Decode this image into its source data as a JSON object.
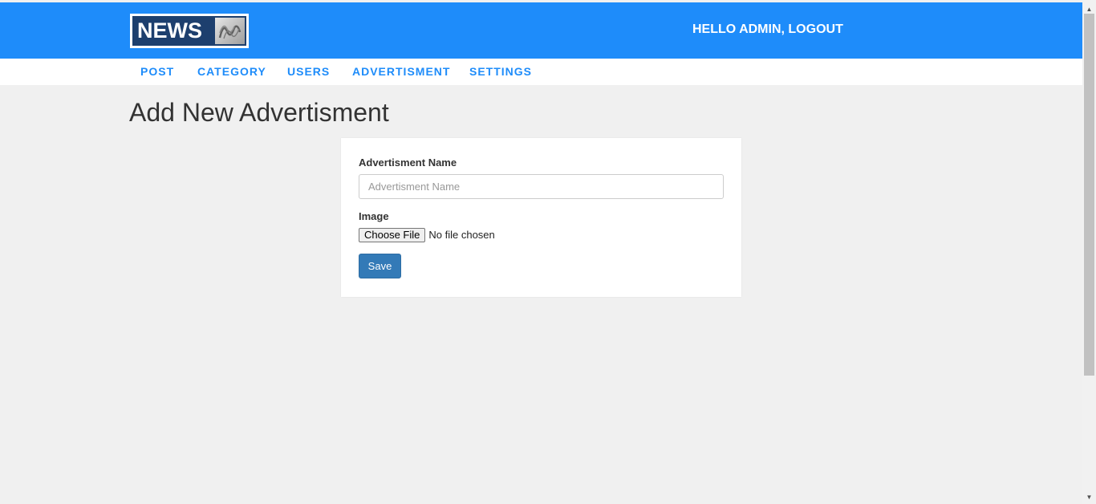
{
  "header": {
    "logo_text": "NEWS",
    "user_greeting": "HELLO ADMIN,",
    "logout_label": "LOGOUT"
  },
  "nav": {
    "items": [
      {
        "label": "POST"
      },
      {
        "label": "CATEGORY"
      },
      {
        "label": "USERS"
      },
      {
        "label": "ADVERTISMENT"
      },
      {
        "label": "SETTINGS"
      }
    ]
  },
  "main": {
    "title": "Add New Advertisment",
    "form": {
      "name_label": "Advertisment Name",
      "name_placeholder": "Advertisment Name",
      "name_value": "",
      "image_label": "Image",
      "file_button_label": "Choose File",
      "file_status": "No file chosen",
      "save_label": "Save"
    }
  },
  "scrollbar": {
    "up_arrow": "▲",
    "down_arrow": "▼"
  },
  "colors": {
    "brand_blue": "#1e8cfa",
    "button_blue": "#337ab7",
    "logo_navy": "#1d3f6e"
  }
}
